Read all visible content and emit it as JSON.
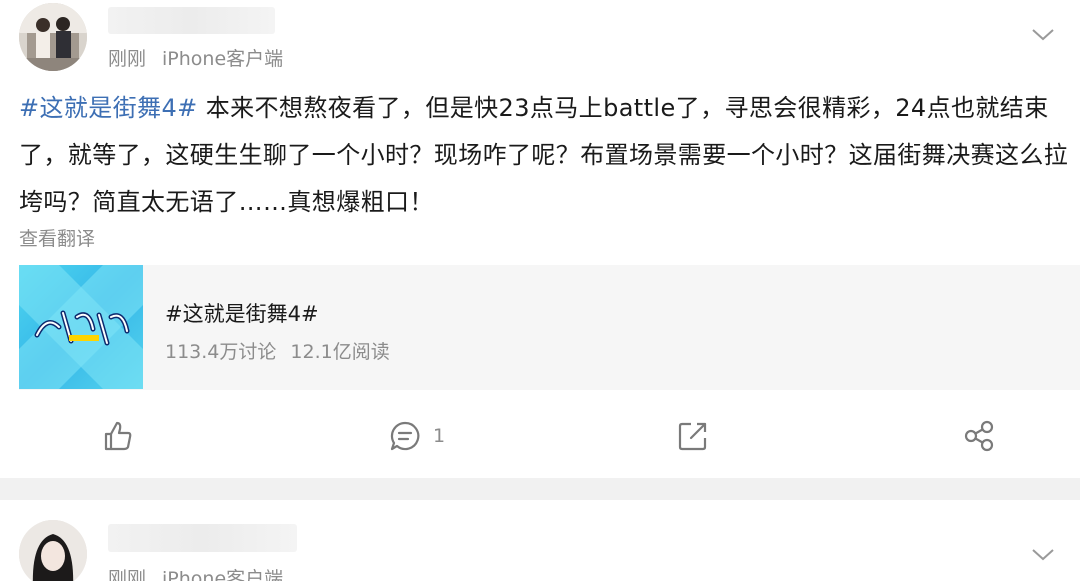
{
  "post1": {
    "meta": {
      "time": "刚刚",
      "source": "iPhone客户端"
    },
    "hashtag": "#这就是街舞4#",
    "body": " 本来不想熬夜看了，但是快23点马上battle了，寻思会很精彩，24点也就结束了，就等了，这硬生生聊了一个小时？现场咋了呢？布置场景需要一个小时？这届街舞决赛这么拉垮吗？简直太无语了……真想爆粗口！",
    "translate_label": "查看翻译",
    "topic": {
      "title": "#这就是街舞4#",
      "discussions": "113.4万讨论",
      "reads": "12.1亿阅读"
    },
    "actions": {
      "like_icon": "thumbs-up-icon",
      "comment_icon": "comment-icon",
      "comment_count": "1",
      "repost_icon": "repost-icon",
      "share_icon": "share-icon"
    }
  },
  "post2": {
    "meta": {
      "time": "刚刚",
      "source": "iPhone客户端"
    }
  },
  "colors": {
    "hashtag": "#3d6fb4",
    "secondary_text": "#8c8c8c",
    "separator": "#f1f1f1"
  }
}
